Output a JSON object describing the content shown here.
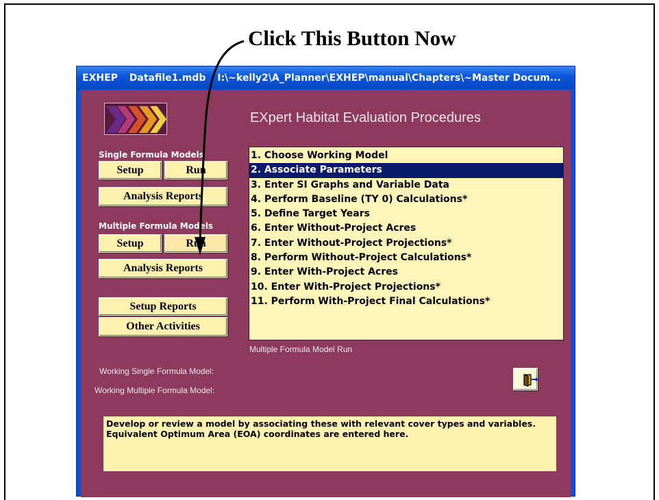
{
  "callout": "Click This Button Now",
  "window": {
    "title_app": "EXHEP",
    "title_file": "Datafile1.mdb",
    "title_path": "I:\\~kelly2\\A_Planner\\EXHEP\\manual\\Chapters\\~Master Docum..."
  },
  "app_title": "EXpert Habitat Evaluation Procedures",
  "single": {
    "label": "Single Formula Models",
    "setup": "Setup",
    "run": "Run",
    "reports": "Analysis Reports"
  },
  "multiple": {
    "label": "Multiple Formula Models",
    "setup": "Setup",
    "run": "Run",
    "reports": "Analysis Reports"
  },
  "setup_reports": "Setup Reports",
  "other_activities": "Other Activities",
  "steps": [
    "1. Choose Working Model",
    "2. Associate Parameters",
    "3. Enter SI Graphs and Variable Data",
    "4. Perform Baseline (TY 0) Calculations*",
    "5. Define Target Years",
    "6. Enter Without-Project Acres",
    "7. Enter Without-Project Projections*",
    "8. Perform Without-Project Calculations*",
    "9. Enter With-Project Acres",
    "10. Enter With-Project Projections*",
    "11. Perform With-Project Final Calculations*"
  ],
  "selected_step": 2,
  "mode_caption": "Multiple Formula Model Run",
  "working_single_label": "Working Single Formula Model:",
  "working_multiple_label": "Working Multiple Formula Model:",
  "exit_icon": "exit-door-icon",
  "description": "Develop or review a model by associating these with relevant cover types and variables.  Equivalent Optimum Area (EOA) coordinates are entered here.",
  "colors": {
    "background": "#8e3a5c",
    "button": "#fff2b0",
    "list_bg": "#fff5b8",
    "selection": "#0a1a6a",
    "titlebar": "#0a57dc"
  }
}
